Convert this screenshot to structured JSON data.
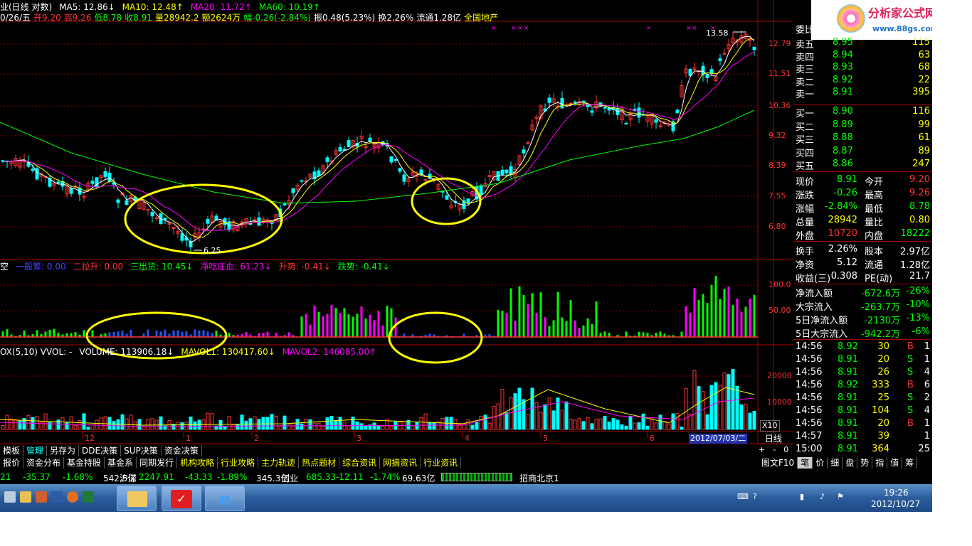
{
  "header": {
    "line1": [
      {
        "text": "业(日线 对数)",
        "color": "#ffffff"
      },
      {
        "text": "MA5: 12.86↓",
        "color": "#ffffff"
      },
      {
        "text": "MA10: 12.48↑",
        "color": "#ffff00"
      },
      {
        "text": "MA20: 11.72↑",
        "color": "#ff00ff"
      },
      {
        "text": "MA60: 10.19↑",
        "color": "#00ff00"
      }
    ],
    "line2": [
      {
        "text": "0/26/五",
        "color": "#ffffff"
      },
      {
        "text": "开9.20",
        "color": "#ff3333"
      },
      {
        "text": "高9.26",
        "color": "#ff3333"
      },
      {
        "text": "低8.78",
        "color": "#00ff00"
      },
      {
        "text": "收8.91",
        "color": "#00ff00"
      },
      {
        "text": "量28942.2",
        "color": "#ffff00"
      },
      {
        "text": "额2624万",
        "color": "#ffff00"
      },
      {
        "text": "幅-0.26(-2.84%)",
        "color": "#00ff00"
      },
      {
        "text": "振0.48(5.23%)",
        "color": "#ffffff"
      },
      {
        "text": "换2.26%",
        "color": "#ffffff"
      },
      {
        "text": "流通1.28亿",
        "color": "#ffffff"
      },
      {
        "text": "全国地产",
        "color": "#ffff00"
      }
    ]
  },
  "price_axis": [
    "12.79",
    "11.51",
    "10.36",
    "9.32",
    "8.39",
    "7.55",
    "6.80"
  ],
  "annotations": {
    "high_label": "13.58",
    "low_label": "6.25"
  },
  "indicator_header": [
    {
      "text": "空",
      "color": "#ffffff"
    },
    {
      "text": "一般筹: 0.00",
      "color": "#4444ff"
    },
    {
      "text": "二拉升: 0.00",
      "color": "#ff3333"
    },
    {
      "text": "三出货: 10.45↓",
      "color": "#00ff00"
    },
    {
      "text": "净吃庄血: 61.23↓",
      "color": "#ff00ff"
    },
    {
      "text": "升势: -0.41↓",
      "color": "#ff3333"
    },
    {
      "text": "跌势: -0.41↓",
      "color": "#00ff00"
    }
  ],
  "indicator_axis": [
    "100.0",
    "50.00"
  ],
  "volume_header": [
    {
      "text": "OX(5,10) VVOL: -",
      "color": "#ffffff"
    },
    {
      "text": "VOLUME: 113906.18↓",
      "color": "#ffffff"
    },
    {
      "text": "MAVOL1: 130417.60↓",
      "color": "#ffff00"
    },
    {
      "text": "MAVOL2: 146085.00↑",
      "color": "#ff00ff"
    }
  ],
  "volume_axis": [
    "20000",
    "10000"
  ],
  "volume_scale": "X10",
  "time_axis": [
    "12",
    "1",
    "2",
    "3",
    "4",
    "5",
    "6"
  ],
  "current_date": "2012/07/03/二",
  "period_label": "日线",
  "zoom_controls": [
    "+",
    "-",
    "0"
  ],
  "logo": {
    "name": "分析家公式网",
    "url": "www.88gs.com"
  },
  "order_book": {
    "title": "委比",
    "asks": [
      {
        "label": "卖五",
        "price": "8.95",
        "vol": "115"
      },
      {
        "label": "卖四",
        "price": "8.94",
        "vol": "63"
      },
      {
        "label": "卖三",
        "price": "8.93",
        "vol": "68"
      },
      {
        "label": "卖二",
        "price": "8.92",
        "vol": "22"
      },
      {
        "label": "卖一",
        "price": "8.91",
        "vol": "395"
      }
    ],
    "bids": [
      {
        "label": "买一",
        "price": "8.90",
        "vol": "116"
      },
      {
        "label": "买二",
        "price": "8.89",
        "vol": "99"
      },
      {
        "label": "买三",
        "price": "8.88",
        "vol": "61"
      },
      {
        "label": "买四",
        "price": "8.87",
        "vol": "89"
      },
      {
        "label": "买五",
        "price": "8.86",
        "vol": "247"
      }
    ]
  },
  "quote": [
    {
      "l1": "现价",
      "v1": "8.91",
      "c1": "#00ff00",
      "l2": "今开",
      "v2": "9.20",
      "c2": "#ff3333"
    },
    {
      "l1": "涨跌",
      "v1": "-0.26",
      "c1": "#00ff00",
      "l2": "最高",
      "v2": "9.26",
      "c2": "#ff3333"
    },
    {
      "l1": "涨幅",
      "v1": "-2.84%",
      "c1": "#00ff00",
      "l2": "最低",
      "v2": "8.78",
      "c2": "#00ff00"
    },
    {
      "l1": "总量",
      "v1": "28942",
      "c1": "#ffff00",
      "l2": "量比",
      "v2": "0.80",
      "c2": "#ffff00"
    },
    {
      "l1": "外盘",
      "v1": "10720",
      "c1": "#ff3333",
      "l2": "内盘",
      "v2": "18222",
      "c2": "#00ff00"
    }
  ],
  "stats": [
    {
      "l1": "换手",
      "v1": "2.26%",
      "l2": "股本",
      "v2": "2.97亿"
    },
    {
      "l1": "净资",
      "v1": "5.12",
      "l2": "流通",
      "v2": "1.28亿"
    },
    {
      "l1": "收益(三)",
      "v1": "0.308",
      "l2": "PE(动)",
      "v2": "21.7"
    }
  ],
  "flows": [
    {
      "label": "净流入额",
      "value": "-672.6万",
      "pct": "-26%"
    },
    {
      "label": "大宗流入",
      "value": "-263.7万",
      "pct": "-10%"
    },
    {
      "label": "5日净流入额",
      "value": "-2130万",
      "pct": "-13%"
    },
    {
      "label": "5日大宗流入",
      "value": "-942.2万",
      "pct": "-6%"
    }
  ],
  "ticks": [
    {
      "time": "14:56",
      "price": "8.92",
      "vol": "30",
      "side": "B",
      "n": "1"
    },
    {
      "time": "14:56",
      "price": "8.91",
      "vol": "20",
      "side": "S",
      "n": "1"
    },
    {
      "time": "14:56",
      "price": "8.91",
      "vol": "26",
      "side": "S",
      "n": "4"
    },
    {
      "time": "14:56",
      "price": "8.92",
      "vol": "333",
      "side": "B",
      "n": "6"
    },
    {
      "time": "14:56",
      "price": "8.91",
      "vol": "25",
      "side": "S",
      "n": "2"
    },
    {
      "time": "14:56",
      "price": "8.91",
      "vol": "104",
      "side": "S",
      "n": "4"
    },
    {
      "time": "14:56",
      "price": "8.91",
      "vol": "20",
      "side": "B",
      "n": "1"
    },
    {
      "time": "14:57",
      "price": "8.91",
      "vol": "39",
      "side": "",
      "n": "1"
    },
    {
      "time": "15:00",
      "price": "8.91",
      "vol": "364",
      "side": "",
      "n": "25"
    }
  ],
  "menu1": [
    "模板",
    "管理",
    "另存为",
    "DDE决策",
    "SUP决策",
    "资金决策"
  ],
  "menu2": [
    "报价",
    "资金分布",
    "基金持股",
    "基金系",
    "同期发行",
    "机构攻略",
    "行业攻略",
    "主力轨迹",
    "热点题材",
    "综合资讯",
    "网摘资讯",
    "行业资讯"
  ],
  "right_tabs": [
    "图文F10",
    "笔",
    "价",
    "细",
    "盘",
    "势",
    "指",
    "值",
    "筹"
  ],
  "ticker": [
    {
      "text": "21",
      "color": "#00ff00"
    },
    {
      "text": "-35.37",
      "color": "#00ff00"
    },
    {
      "text": "-1.68%",
      "color": "#00ff00"
    },
    {
      "text": "542.5亿",
      "color": "#ffffff"
    },
    {
      "text": "沪深",
      "color": "#ffffff"
    },
    {
      "text": "2247.91",
      "color": "#00ff00"
    },
    {
      "text": "-43.33",
      "color": "#00ff00"
    },
    {
      "text": "-1.89%",
      "color": "#00ff00"
    },
    {
      "text": "345.3亿",
      "color": "#ffffff"
    },
    {
      "text": "创业",
      "color": "#ffffff"
    },
    {
      "text": "685.33",
      "color": "#00ff00"
    },
    {
      "text": "-12.11",
      "color": "#00ff00"
    },
    {
      "text": "-1.74%",
      "color": "#00ff00"
    },
    {
      "text": "69.63亿",
      "color": "#ffffff"
    },
    {
      "text": "招商北京1",
      "color": "#ffffff"
    }
  ],
  "clock": {
    "time": "19:26",
    "date": "2012/10/27"
  },
  "colors": {
    "up": "#ff3333",
    "down": "#00ffff",
    "ma5": "#ffffff",
    "ma10": "#ffff00",
    "ma20": "#ff00ff",
    "ma60": "#00ff00",
    "grid": "#8b0000",
    "circle": "#ffff00"
  }
}
